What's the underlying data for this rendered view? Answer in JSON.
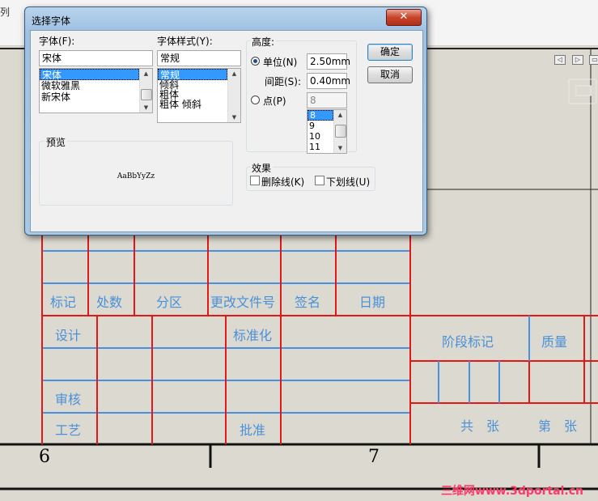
{
  "dialog": {
    "title": "选择字体",
    "close_symbol": "✕",
    "font_label": "字体(F):",
    "font_value": "宋体",
    "font_list": [
      "宋体",
      "微软雅黑",
      "新宋体"
    ],
    "style_label": "字体样式(Y):",
    "style_value": "常规",
    "style_list": [
      "常规",
      "倾斜",
      "粗体",
      "粗体 倾斜"
    ],
    "height_group": "高度:",
    "unit_label": "单位(N)",
    "unit_value": "2.50mm",
    "spacing_label": "间距(S):",
    "spacing_value": "0.40mm",
    "point_label": "点(P)",
    "point_value": "8",
    "point_list": [
      "8",
      "9",
      "10",
      "11"
    ],
    "preview_group": "预览",
    "preview_sample": "AaBbYyZz",
    "effects_group": "效果",
    "strikeout_label": "删除线(K)",
    "underline_label": "下划线(U)",
    "ok_label": "确定",
    "cancel_label": "取消"
  },
  "background": {
    "toolbar_fragment": "列",
    "title_block": {
      "row_labels": [
        "标记",
        "处数",
        "分区",
        "更改文件号",
        "签名",
        "日期"
      ],
      "design": "设计",
      "standardize": "标准化",
      "stage_mark": "阶段标记",
      "mass": "质量",
      "review": "审核",
      "process": "工艺",
      "approve": "批准",
      "total_sheets": "共　张",
      "sheet_no": "第　张"
    },
    "zone_numbers": [
      "6",
      "7"
    ],
    "watermark": "三维网www.3dportal.cn"
  },
  "colors": {
    "blue_line": "#4a90e2",
    "red_line": "#e01818",
    "text_blue": "#4a90d9"
  }
}
